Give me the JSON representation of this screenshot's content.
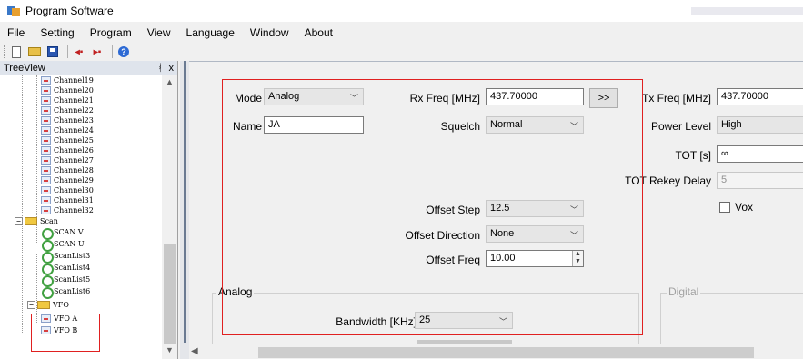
{
  "window": {
    "title": "Program Software"
  },
  "menu": [
    "File",
    "Setting",
    "Program",
    "View",
    "Language",
    "Window",
    "About"
  ],
  "toolbar": {
    "icons": [
      "new-file-icon",
      "open-folder-icon",
      "save-icon",
      "read-radio-icon",
      "write-radio-icon",
      "help-icon"
    ]
  },
  "treeview": {
    "title": "TreeView",
    "pin_glyph": "x",
    "channels": [
      "Channel19",
      "Channel20",
      "Channel21",
      "Channel22",
      "Channel23",
      "Channel24",
      "Channel25",
      "Channel26",
      "Channel27",
      "Channel28",
      "Channel29",
      "Channel30",
      "Channel31",
      "Channel32"
    ],
    "scan_folder": "Scan",
    "scan_items": [
      "SCAN V",
      "SCAN U",
      "ScanList3",
      "ScanList4",
      "ScanList5",
      "ScanList6"
    ],
    "vfo_folder": "VFO",
    "vfo_items": [
      "VFO A",
      "VFO B"
    ]
  },
  "form": {
    "mode_label": "Mode",
    "mode_value": "Analog",
    "name_label": "Name",
    "name_value": "JA",
    "rx_freq_label": "Rx Freq [MHz]",
    "rx_freq_value": "437.70000",
    "copy_button": ">>",
    "squelch_label": "Squelch",
    "squelch_value": "Normal",
    "tx_freq_label": "Tx Freq [MHz]",
    "tx_freq_value": "437.70000",
    "power_level_label": "Power Level",
    "power_level_value": "High",
    "tot_label": "TOT [s]",
    "tot_value": "∞",
    "tot_rekey_label": "TOT Rekey Delay",
    "tot_rekey_value": "5",
    "vox_label": "Vox",
    "offset_step_label": "Offset Step",
    "offset_step_value": "12.5",
    "offset_direction_label": "Offset Direction",
    "offset_direction_value": "None",
    "offset_freq_label": "Offset Freq",
    "offset_freq_value": "10.00",
    "analog_group": "Analog",
    "digital_group": "Digital",
    "bandwidth_label": "Bandwidth [KHz]",
    "bandwidth_value": "25"
  }
}
